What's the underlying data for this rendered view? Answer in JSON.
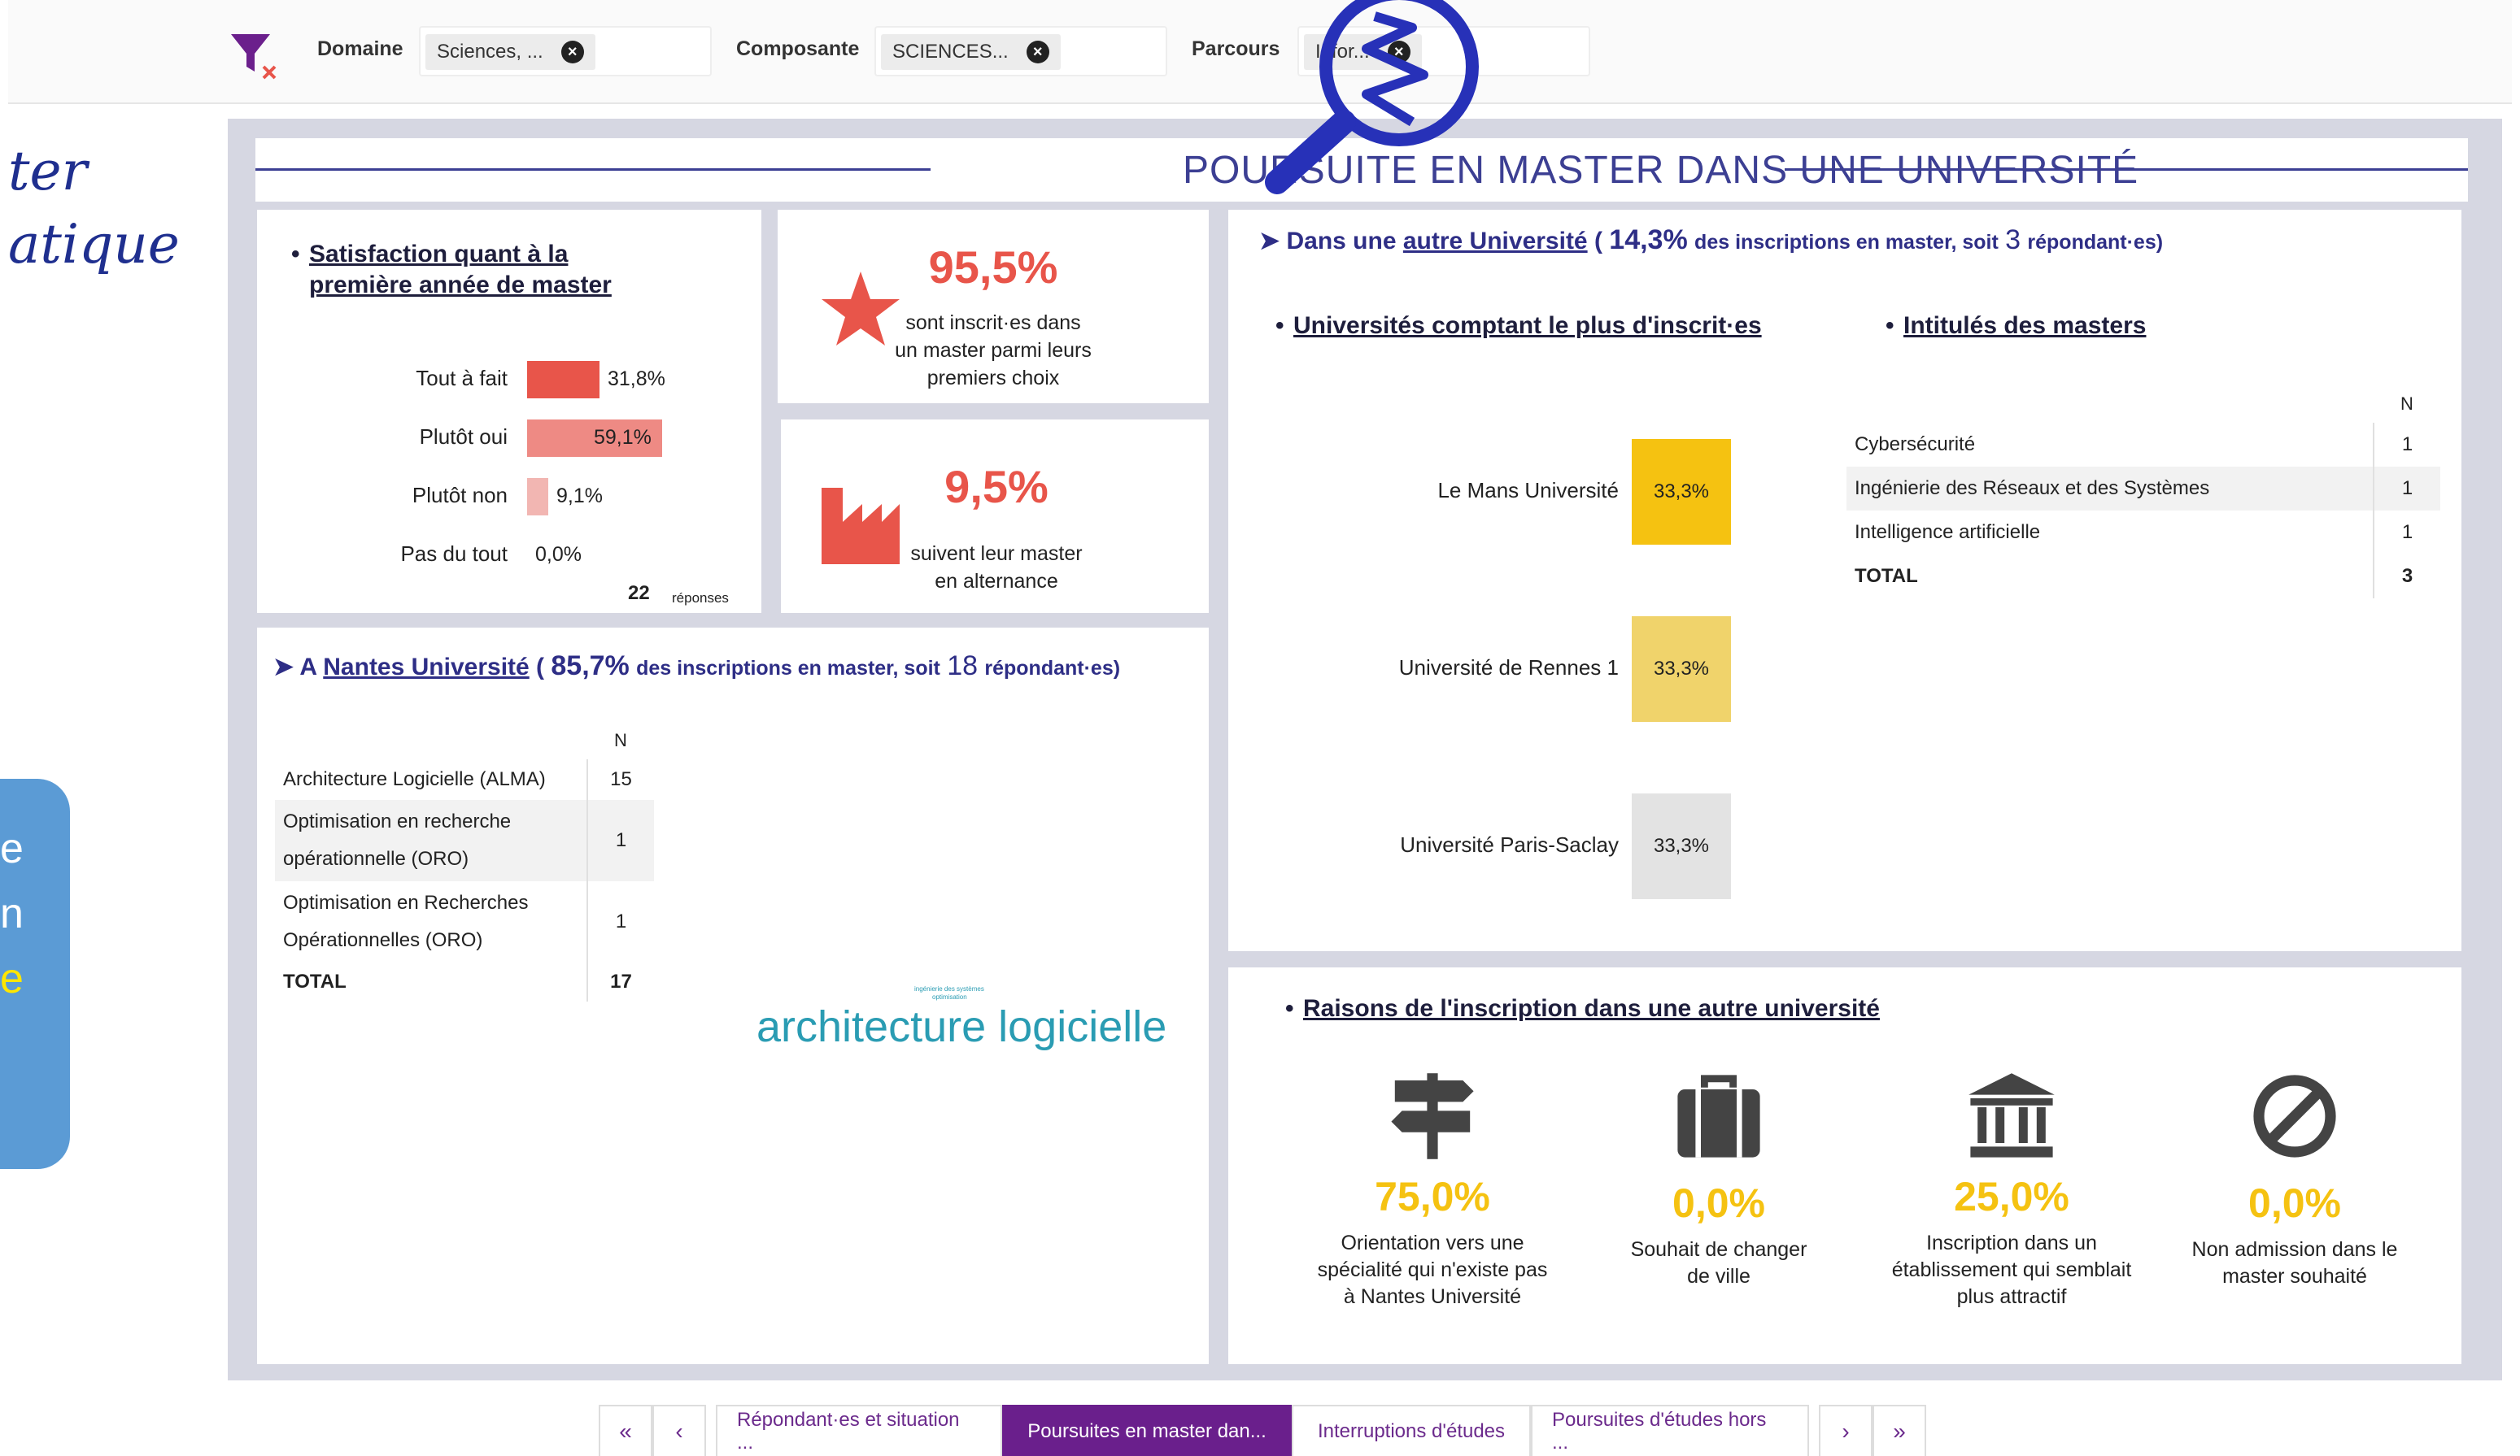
{
  "filters": [
    {
      "label": "Domaine",
      "value": "Sciences, ..."
    },
    {
      "label": "Composante",
      "value": "SCIENCES..."
    },
    {
      "label": "Parcours",
      "value": "Infor..."
    }
  ],
  "overlay": {
    "handwriting_line1": "ter",
    "handwriting_line2": "atique",
    "callout_line1": "e",
    "callout_line2": "n",
    "callout_line3": "e"
  },
  "title": "POURSUITE EN MASTER DANS UNE UNIVERSITÉ",
  "satisfaction": {
    "title_line1": "Satisfaction quant à la",
    "title_line2": "première année de master",
    "rows": [
      {
        "label": "Tout à fait",
        "pct": 31.8,
        "value": "31,8%",
        "color": "#e8554a"
      },
      {
        "label": "Plutôt oui",
        "pct": 59.1,
        "value": "59,1%",
        "color": "#ee8a84"
      },
      {
        "label": "Plutôt non",
        "pct": 9.1,
        "value": "9,1%",
        "color": "#f2b6b2"
      },
      {
        "label": "Pas du tout",
        "pct": 0.0,
        "value": "0,0%",
        "color": "#f5cfcc"
      }
    ],
    "responses_count": "22",
    "responses_label": "réponses"
  },
  "kpi_choice": {
    "value": "95,5%",
    "line1": "sont inscrit·es dans",
    "line2": "un master parmi leurs",
    "line3": "premiers choix"
  },
  "kpi_alternance": {
    "value": "9,5%",
    "line1": "suivent leur master",
    "line2": "en alternance"
  },
  "nantes": {
    "prefix": "A",
    "link": "Nantes Université",
    "pct": "85,7%",
    "mid": "des inscriptions en master, soit",
    "count": "18",
    "suffix": "répondant·es)",
    "table_header": "N",
    "rows": [
      {
        "label": "Architecture Logicielle (ALMA)",
        "n": "15"
      },
      {
        "label_line1": "Optimisation en recherche",
        "label_line2": "opérationnelle (ORO)",
        "n": "1"
      },
      {
        "label_line1": "Optimisation en Recherches",
        "label_line2": "Opérationnelles (ORO)",
        "n": "1"
      }
    ],
    "total_label": "TOTAL",
    "total_n": "17",
    "wordcloud_main": "architecture logicielle",
    "wordcloud_small1": "ingénierie des systèmes",
    "wordcloud_small2": "optimisation"
  },
  "other": {
    "prefix": "Dans une",
    "link": "autre Université",
    "pct": "14,3%",
    "mid": "des inscriptions en master, soit",
    "count": "3",
    "suffix": "répondant·es)",
    "universities_title": "Universités comptant le plus d'inscrit·es",
    "universities": [
      {
        "name": "Le Mans Université",
        "value": "33,3%",
        "color": "#f5c211"
      },
      {
        "name": "Université de Rennes 1",
        "value": "33,3%",
        "color": "#f0d36b"
      },
      {
        "name": "Université Paris-Saclay",
        "value": "33,3%",
        "color": "#e3e3e3"
      }
    ],
    "masters_title": "Intitulés des masters",
    "masters_header": "N",
    "masters": [
      {
        "label": "Cybersécurité",
        "n": "1"
      },
      {
        "label": "Ingénierie des Réseaux et des Systèmes",
        "n": "1"
      },
      {
        "label": "Intelligence artificielle",
        "n": "1"
      }
    ],
    "masters_total_label": "TOTAL",
    "masters_total_n": "3"
  },
  "reasons": {
    "title": "Raisons de l'inscription dans une autre université",
    "items": [
      {
        "icon": "signpost-icon",
        "value": "75,0%",
        "line1": "Orientation vers une",
        "line2": "spécialité qui n'existe pas",
        "line3": "à Nantes Université"
      },
      {
        "icon": "briefcase-icon",
        "value": "0,0%",
        "line1": "Souhait de changer",
        "line2": "de ville",
        "line3": ""
      },
      {
        "icon": "institution-icon",
        "value": "25,0%",
        "line1": "Inscription dans un",
        "line2": "établissement qui semblait",
        "line3": "plus attractif"
      },
      {
        "icon": "prohibited-icon",
        "value": "0,0%",
        "line1": "Non admission dans le",
        "line2": "master souhaité",
        "line3": ""
      }
    ]
  },
  "tabs": {
    "first": "«",
    "prev": "‹",
    "items": [
      {
        "label": "Répondant·es et situation ...",
        "active": false
      },
      {
        "label": "Poursuites en master dan...",
        "active": true
      },
      {
        "label": "Interruptions d'études",
        "active": false
      },
      {
        "label": "Poursuites d'études hors ...",
        "active": false
      }
    ],
    "next": "›",
    "last": "»"
  }
}
